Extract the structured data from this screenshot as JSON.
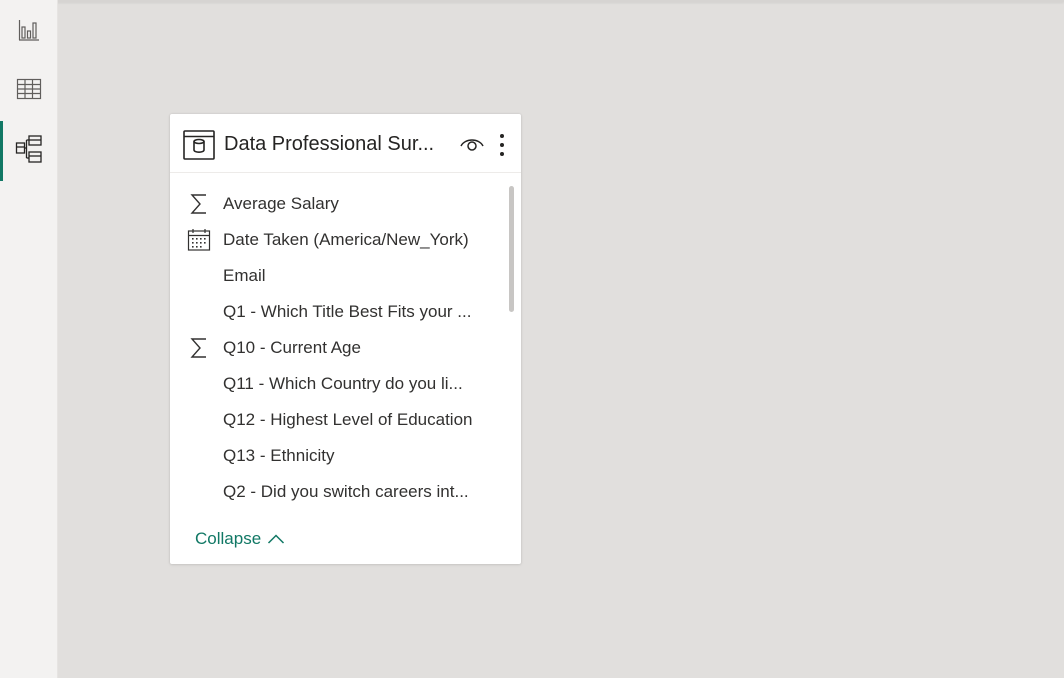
{
  "rail": {
    "items": [
      {
        "name": "report-view",
        "icon": "bar-chart-icon",
        "active": false
      },
      {
        "name": "data-view",
        "icon": "table-grid-icon",
        "active": false
      },
      {
        "name": "model-view",
        "icon": "model-diagram-icon",
        "active": true
      }
    ],
    "accent": "#117865"
  },
  "card": {
    "title": "Data Professional Sur...",
    "fields": [
      {
        "icon": "sigma-icon",
        "label": "Average Salary"
      },
      {
        "icon": "calendar-icon",
        "label": "Date Taken (America/New_York)"
      },
      {
        "icon": "",
        "label": "Email"
      },
      {
        "icon": "",
        "label": "Q1 - Which Title Best Fits your ..."
      },
      {
        "icon": "sigma-icon",
        "label": "Q10 - Current Age"
      },
      {
        "icon": "",
        "label": "Q11 - Which Country do you li..."
      },
      {
        "icon": "",
        "label": "Q12 - Highest Level of Education"
      },
      {
        "icon": "",
        "label": "Q13 - Ethnicity"
      },
      {
        "icon": "",
        "label": "Q2 - Did you switch careers int..."
      }
    ],
    "collapse_label": "Collapse"
  }
}
